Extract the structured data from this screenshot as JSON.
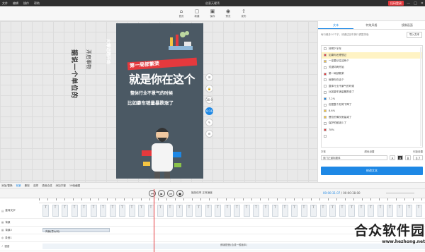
{
  "titlebar": {
    "menu": [
      "文件",
      "编辑",
      "操作",
      "帮助"
    ],
    "title": "创意天曜湾",
    "login": "扫码登录",
    "window_controls": [
      "—",
      "□",
      "✕"
    ]
  },
  "toolbar": {
    "items": [
      {
        "label": "首页",
        "icon": "home-icon"
      },
      {
        "label": "新建",
        "icon": "new-icon"
      },
      {
        "label": "保存",
        "icon": "save-icon"
      },
      {
        "label": "预览",
        "icon": "preview-icon"
      },
      {
        "label": "发布",
        "icon": "publish-icon"
      }
    ]
  },
  "canvas": {
    "side_text_1": "据说一个单位的",
    "side_text_2": "开启事物",
    "phone_rotated": "火爆话题开始",
    "headline_1": "第一局部繁荣",
    "headline_2": "就是你在这个",
    "sub_1": "整体行业不景气的时候",
    "sub_2": "比如豪车销量暴跌涨了",
    "side_buttons": [
      "☰",
      "🔒",
      "16:9",
      "9:16",
      "✎",
      "⚙"
    ],
    "active_button": "9:16"
  },
  "panel": {
    "tabs": [
      "文本",
      "特效风格",
      "镜像画面"
    ],
    "active_tab": "文本",
    "hint": "每行最多10个字，请通过回车换行调整排版",
    "import_btn": "导入文本",
    "rows": [
      {
        "text": "好啊下半年",
        "color": "#ffffff"
      },
      {
        "text": "如果你还理想过",
        "color": "#e5393d"
      },
      {
        "text": "一定要记住这两个",
        "color": "#f5c542"
      },
      {
        "text": "关键词两开始",
        "color": "#ffffff"
      },
      {
        "text": "第一局部繁荣",
        "color": "#e5393d"
      },
      {
        "text": "就是你在这个",
        "color": "#ffffff"
      },
      {
        "text": "整体行业不景气的时候",
        "color": "#ffffff"
      },
      {
        "text": "比如豪车销量暴跌涨了",
        "color": "#ffffff"
      },
      {
        "text": "7.2%",
        "color": "#1e88e5"
      },
      {
        "text": "但是整个形势下降了",
        "color": "#ffffff"
      },
      {
        "text": "8.6%",
        "color": "#f5c542"
      },
      {
        "text": "餐饮的情况常量减了",
        "color": "#f5c542"
      },
      {
        "text": "保护的都减少了",
        "color": "#ffffff"
      },
      {
        "text": "78%",
        "color": "#e5393d"
      },
      {
        "text": "",
        "color": "#ffffff"
      }
    ],
    "selected_row": 1,
    "font_label": "字体",
    "color_label": "颜色设置",
    "spacing_label": "行距设置",
    "font_value": "庞门正道标题体",
    "spacing_value": "0.7",
    "main_btn": "修改文本"
  },
  "timeline": {
    "tools": [
      "添加/替换",
      "前景",
      "删除",
      "选择",
      "语音合成",
      "添加字幕",
      "16帧截图"
    ],
    "selected_tool": "前景",
    "speed": "播放倍率 正常速度",
    "time_current": "00:00:31.07",
    "time_total": "00:00:38.00",
    "tracks": [
      {
        "name": "旋转文字",
        "icon": "text-track-icon"
      },
      {
        "name": "背景",
        "icon": "bg-track-icon"
      },
      {
        "name": "背景2",
        "icon": "bg2-track-icon"
      },
      {
        "name": "录音1",
        "icon": "mic-track-icon"
      },
      {
        "name": "语音",
        "icon": "audio-track-icon"
      }
    ],
    "bg_clip": "背景(意大利)",
    "audio_clip": "朗读配音(合成一般版本)"
  },
  "watermark": {
    "big": "合众软件园",
    "small": "www.hezhong.net"
  }
}
